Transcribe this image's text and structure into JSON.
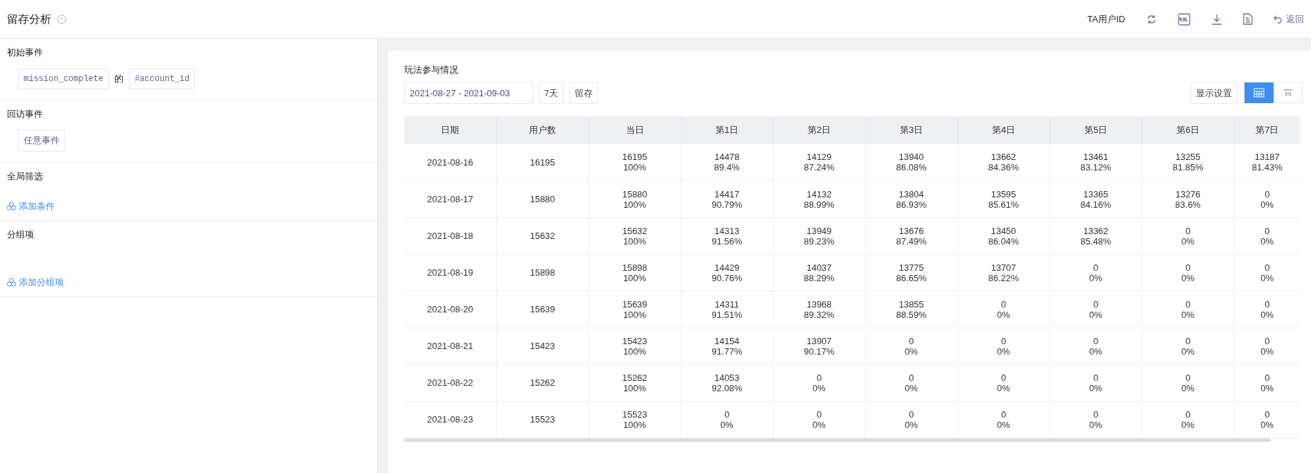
{
  "header": {
    "title": "留存分析",
    "user_id_label": "TA用户ID",
    "back_label": "返回"
  },
  "sidebar": {
    "sections": [
      {
        "kind": "event",
        "title": "初始事件",
        "tags": [
          "mission_complete",
          "#account_id"
        ],
        "joiner": "的"
      },
      {
        "kind": "event",
        "title": "回访事件",
        "tags": [
          "任意事件"
        ]
      },
      {
        "kind": "add",
        "title": "全局筛选",
        "action": "添加条件"
      },
      {
        "kind": "add-tall",
        "title": "分组项",
        "action": "添加分组项"
      }
    ]
  },
  "report": {
    "title": "玩法参与情况",
    "date_range": "2021-08-27 - 2021-09-03",
    "period": "7天",
    "mode": "留存",
    "display_settings": "显示设置",
    "view_toggle": [
      {
        "kind": "table",
        "selected": true
      },
      {
        "kind": "chart",
        "selected": false
      }
    ]
  },
  "table": {
    "columns": [
      "日期",
      "用户数",
      "当日",
      "第1日",
      "第2日",
      "第3日",
      "第4日",
      "第5日",
      "第6日",
      "第7日"
    ],
    "rows": [
      [
        "2021-08-16",
        "16195",
        "16195\n100%",
        "14478\n89.4%",
        "14129\n87.24%",
        "13940\n86.08%",
        "13662\n84.36%",
        "13461\n83.12%",
        "13255\n81.85%",
        "13187\n81.43%"
      ],
      [
        "2021-08-17",
        "15880",
        "15880\n100%",
        "14417\n90.79%",
        "14132\n88.99%",
        "13804\n86.93%",
        "13595\n85.61%",
        "13365\n84.16%",
        "13276\n83.6%",
        "0\n0%"
      ],
      [
        "2021-08-18",
        "15632",
        "15632\n100%",
        "14313\n91.56%",
        "13949\n89.23%",
        "13676\n87.49%",
        "13450\n86.04%",
        "13362\n85.48%",
        "0\n0%",
        "0\n0%"
      ],
      [
        "2021-08-19",
        "15898",
        "15898\n100%",
        "14429\n90.76%",
        "14037\n88.29%",
        "13775\n86.65%",
        "13707\n86.22%",
        "0\n0%",
        "0\n0%",
        "0\n0%"
      ],
      [
        "2021-08-20",
        "15639",
        "15639\n100%",
        "14311\n91.51%",
        "13968\n89.32%",
        "13855\n88.59%",
        "0\n0%",
        "0\n0%",
        "0\n0%",
        "0\n0%"
      ],
      [
        "2021-08-21",
        "15423",
        "15423\n100%",
        "14154\n91.77%",
        "13907\n90.17%",
        "0\n0%",
        "0\n0%",
        "0\n0%",
        "0\n0%",
        "0\n0%"
      ],
      [
        "2021-08-22",
        "15262",
        "15262\n100%",
        "14053\n92.08%",
        "0\n0%",
        "0\n0%",
        "0\n0%",
        "0\n0%",
        "0\n0%",
        "0\n0%"
      ],
      [
        "2021-08-23",
        "15523",
        "15523\n100%",
        "0\n0%",
        "0\n0%",
        "0\n0%",
        "0\n0%",
        "0\n0%",
        "0\n0%",
        "0\n0%"
      ]
    ]
  }
}
